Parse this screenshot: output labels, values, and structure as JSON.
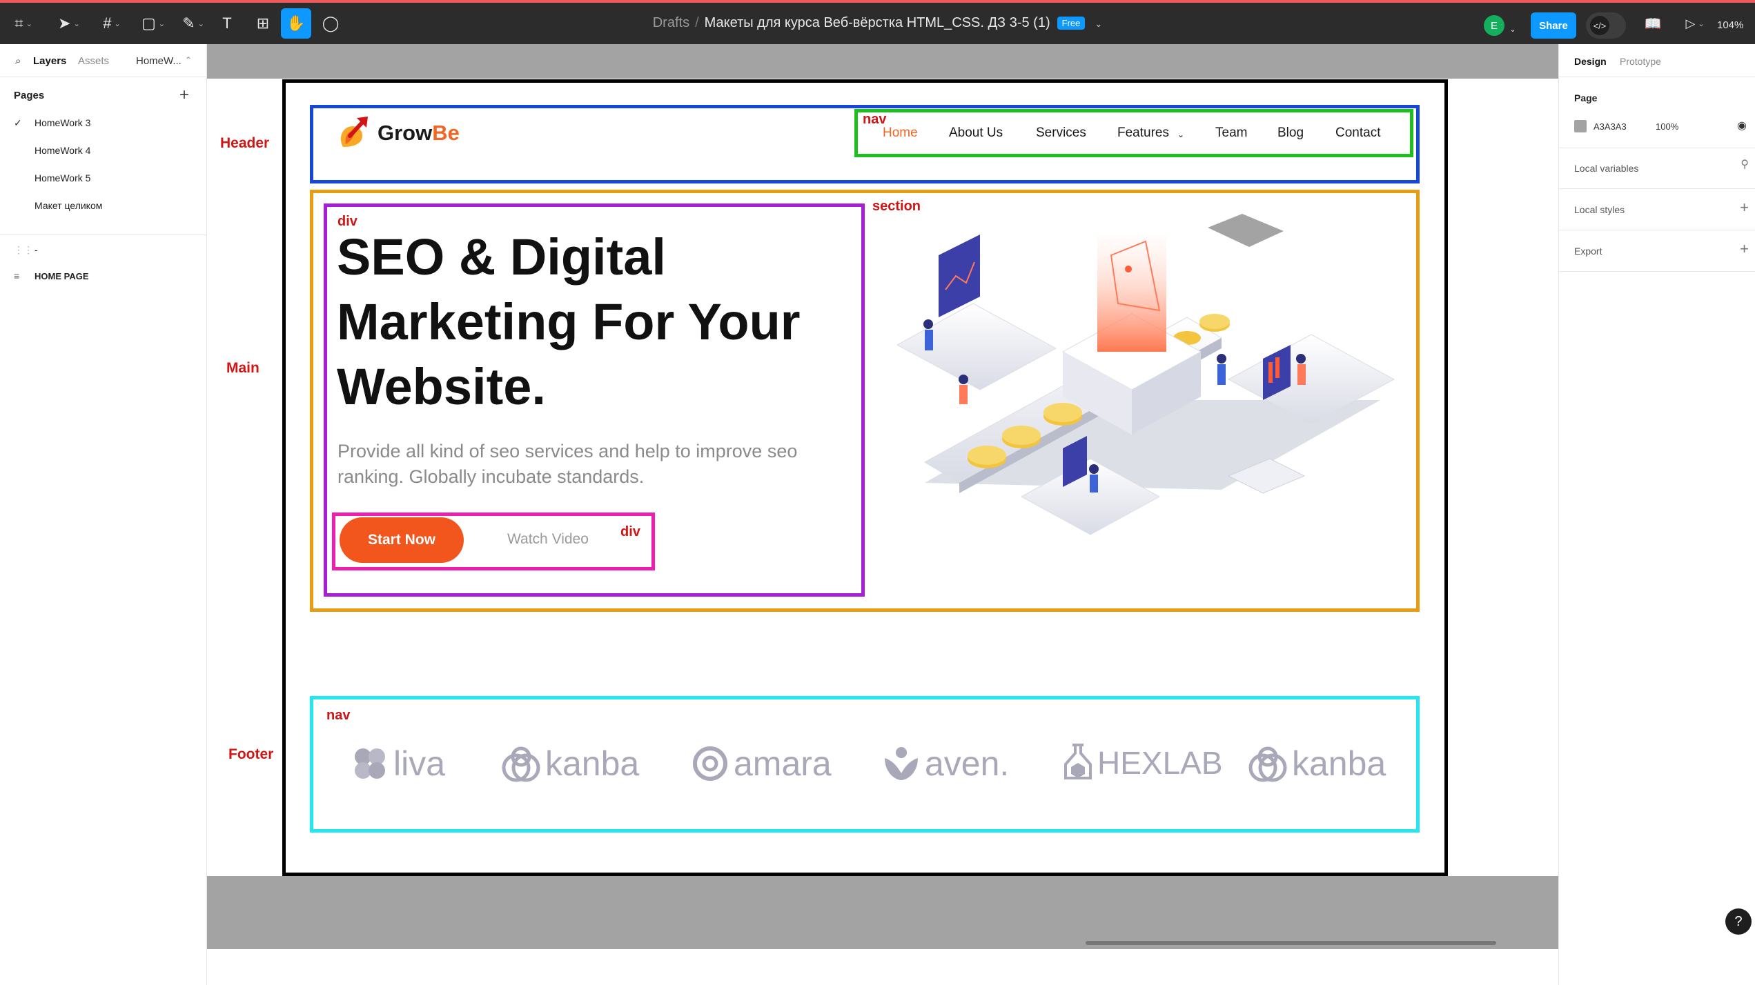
{
  "toolbar": {
    "breadcrumb": "Drafts",
    "file_title": "Макеты для курса Веб-вёрстка HTML_CSS. ДЗ 3-5 (1)",
    "badge": "Free",
    "avatar_letter": "E",
    "share_label": "Share",
    "zoom": "104%"
  },
  "left_panel": {
    "tabs": [
      "Layers",
      "Assets",
      "HomeW..."
    ],
    "pages_heading": "Pages",
    "pages": [
      "HomeWork 3",
      "HomeWork 4",
      "HomeWork 5",
      "Макет целиком"
    ],
    "selected_page": "HomeWork 3",
    "layers": [
      "-",
      "HOME PAGE"
    ]
  },
  "right_panel": {
    "tabs": [
      "Design",
      "Prototype"
    ],
    "page_heading": "Page",
    "page_color": "A3A3A3",
    "page_opacity": "100%",
    "sections": [
      "Local variables",
      "Local styles",
      "Export"
    ]
  },
  "annotations": {
    "side_labels": {
      "header": "Header",
      "main": "Main",
      "footer": "Footer"
    },
    "tags": {
      "header_nav": "nav",
      "hero_div": "div",
      "section": "section",
      "buttons_div": "div",
      "footer_nav": "nav"
    }
  },
  "site": {
    "logo_text_a": "Grow",
    "logo_text_b": "Be",
    "nav": [
      "Home",
      "About Us",
      "Services",
      "Features",
      "Team",
      "Blog",
      "Contact"
    ],
    "hero_title": "SEO & Digital Marketing For Your Website.",
    "hero_subtitle": "Provide all kind of seo services and help to improve seo ranking. Globally incubate standards.",
    "btn_primary": "Start Now",
    "btn_secondary": "Watch Video",
    "brands": [
      "liva",
      "kanba",
      "amara",
      "aven.",
      "HEXLAB",
      "kanba"
    ]
  },
  "colors": {
    "accent": "#f26522",
    "canvas": "#a3a3a3",
    "figma_blue": "#0d99ff",
    "annot_red": "#d11414"
  }
}
